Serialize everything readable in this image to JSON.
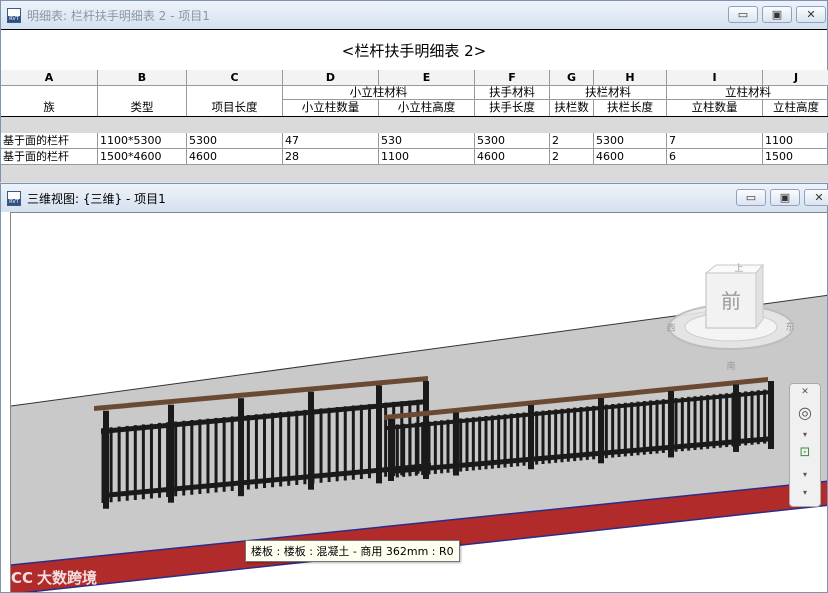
{
  "schedule_window": {
    "title": "明细表: 栏杆扶手明细表 2 - 项目1",
    "icon": "revit-file-icon",
    "buttons": {
      "minimize": "▭",
      "restore": "▣",
      "close": "✕"
    },
    "schedule_title": "<栏杆扶手明细表 2>",
    "column_letters": [
      "A",
      "B",
      "C",
      "D",
      "E",
      "F",
      "G",
      "H",
      "I",
      "J"
    ],
    "group_headers": [
      "小立柱材料",
      "扶手材料",
      "扶栏材料",
      "立柱材料"
    ],
    "headers": [
      "族",
      "类型",
      "项目长度",
      "小立柱数量",
      "小立柱高度",
      "扶手长度",
      "扶栏数",
      "扶栏长度",
      "立柱数量",
      "立柱高度"
    ],
    "rows": [
      [
        "基于面的栏杆",
        "1100*5300",
        "5300",
        "47",
        "530",
        "5300",
        "2",
        "5300",
        "7",
        "1100"
      ],
      [
        "基于面的栏杆",
        "1500*4600",
        "4600",
        "28",
        "1100",
        "4600",
        "2",
        "4600",
        "6",
        "1500"
      ]
    ]
  },
  "view_window": {
    "title": "三维视图: {三维} - 项目1",
    "icon": "revit-file-icon",
    "buttons": {
      "minimize": "▭",
      "restore": "▣",
      "close": "✕"
    },
    "viewcube": {
      "face": "前",
      "top_label": "上",
      "left": "西",
      "right": "东",
      "bottom": "南"
    },
    "tooltip": "楼板 : 楼板 : 混凝土 - 商用 362mm : R0",
    "watermark": "大数跨境",
    "colors": {
      "slab": "#c9c9c9",
      "slab_edge": "#b22b2b",
      "railing": "#1a1a1a",
      "handrail": "#6b4a35"
    }
  }
}
